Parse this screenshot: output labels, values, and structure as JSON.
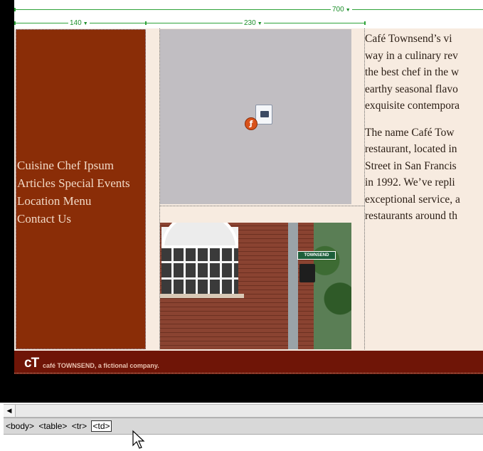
{
  "ruler": {
    "table_width": "700",
    "col1_width": "140",
    "col2_width": "230"
  },
  "nav": {
    "lines": [
      "Cuisine Chef Ipsum",
      "Articles Special Events",
      "Location Menu",
      "Contact Us"
    ]
  },
  "content": {
    "paragraph1": [
      "Café Townsend’s vi",
      "way in a culinary rev",
      "the best chef in the w",
      "earthy seasonal flavo",
      "exquisite contempora"
    ],
    "paragraph2": [
      "The name Café Tow",
      "restaurant, located in",
      "Street in San Francis",
      "in 1992. We’ve repli",
      "exceptional service, a",
      "restaurants around th"
    ]
  },
  "photo": {
    "street_sign": "TOWNSEND"
  },
  "footer": {
    "logo_mark": "cT",
    "text": "café TOWNSEND, a fictional company."
  },
  "tag_selector": {
    "tags": [
      "<body>",
      "<table>",
      "<tr>",
      "<td>"
    ],
    "selected_index": 3
  },
  "colors": {
    "nav_bg": "#8a2d07",
    "page_bg": "#f7ebe0",
    "footer_bg": "#6f1507",
    "ruler_green": "#2fa33a"
  },
  "icons": {
    "plugin": "flash-plugin-placeholder-icon",
    "scroll_left": "scroll-left-arrow-icon",
    "cursor": "mouse-pointer-icon"
  }
}
